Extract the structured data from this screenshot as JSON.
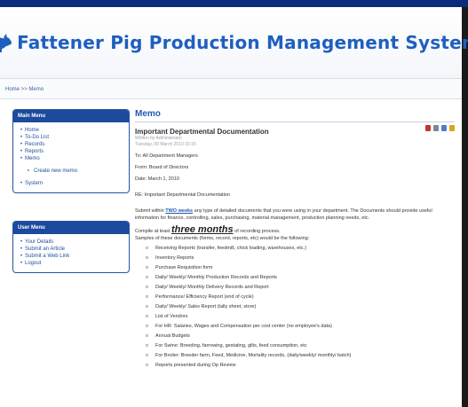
{
  "header": {
    "title": "Fattener Pig Production Management System"
  },
  "breadcrumb": {
    "home": "Home",
    "separator": ">>",
    "current": "Memo"
  },
  "main_menu": {
    "title": "Main Menu",
    "items": [
      "Home",
      "To-Do List",
      "Records",
      "Reports",
      "Memo"
    ],
    "sub_item": "Create new memo",
    "after_item": "System"
  },
  "user_menu": {
    "title": "User Menu",
    "items": [
      "Your Details",
      "Submit an Article",
      "Submit a Web Link",
      "Logout"
    ]
  },
  "content": {
    "section_title": "Memo",
    "article_title": "Important Departmental Documentation",
    "written_by": "Written by Administrator",
    "date_line": "Tuesday, 09 March 2010 15:15",
    "to": "To: All Department Managers",
    "from": "From: Board of Directors",
    "date": "Date: March 1, 2010",
    "re": "RE: Important Departmental Documentation",
    "para1_pre": "Submit within",
    "para1_link": "TWO weeks",
    "para1_post": "any type of detailed documents that you were using in your department. The Documents should provide useful information for finance, controlling, sales, purchasing, material management, production planning needs, etc.",
    "para2_pre": "Compile at least",
    "para2_big": "three months",
    "para2_post": "of recording process.",
    "para3": "Samples of these documents (forms, record, reports, etc) would be the following:",
    "docs": [
      "Receiving Reports (transfer, feedmill, chick loading, warehouses, etc.)",
      "Inventory Reports",
      "Purchase Requisition form",
      "Daily/ Weekly/ Monthly Production Records and Reports",
      "Daily/ Weekly/ Monthly Delivery Records and Report",
      "Performance/ Efficiency Report (end of cycle)",
      "Daily/ Weekly/ Sales Report (tally sheet, store)",
      "List of Vendors",
      "For HR: Salaries, Wages and Compensation per cost center (no employee's data)",
      "Annual Budgets",
      "For Swine: Breeding, farrowing, gestating, gilts, feed consumption, etc",
      "For Broiler: Breeder farm, Feed, Medicine, Mortality records, (daily/weekly/ monthly/ batch)",
      "Reports presented during Op Review"
    ]
  },
  "icons": {
    "pig": "pig-icon",
    "tools": [
      "pdf-icon",
      "print-icon",
      "email-icon",
      "edit-icon"
    ]
  },
  "colors": {
    "brand": "#1f5fbf",
    "menu_header": "#1c4a9c",
    "top_bar": "#0b2c7a"
  }
}
